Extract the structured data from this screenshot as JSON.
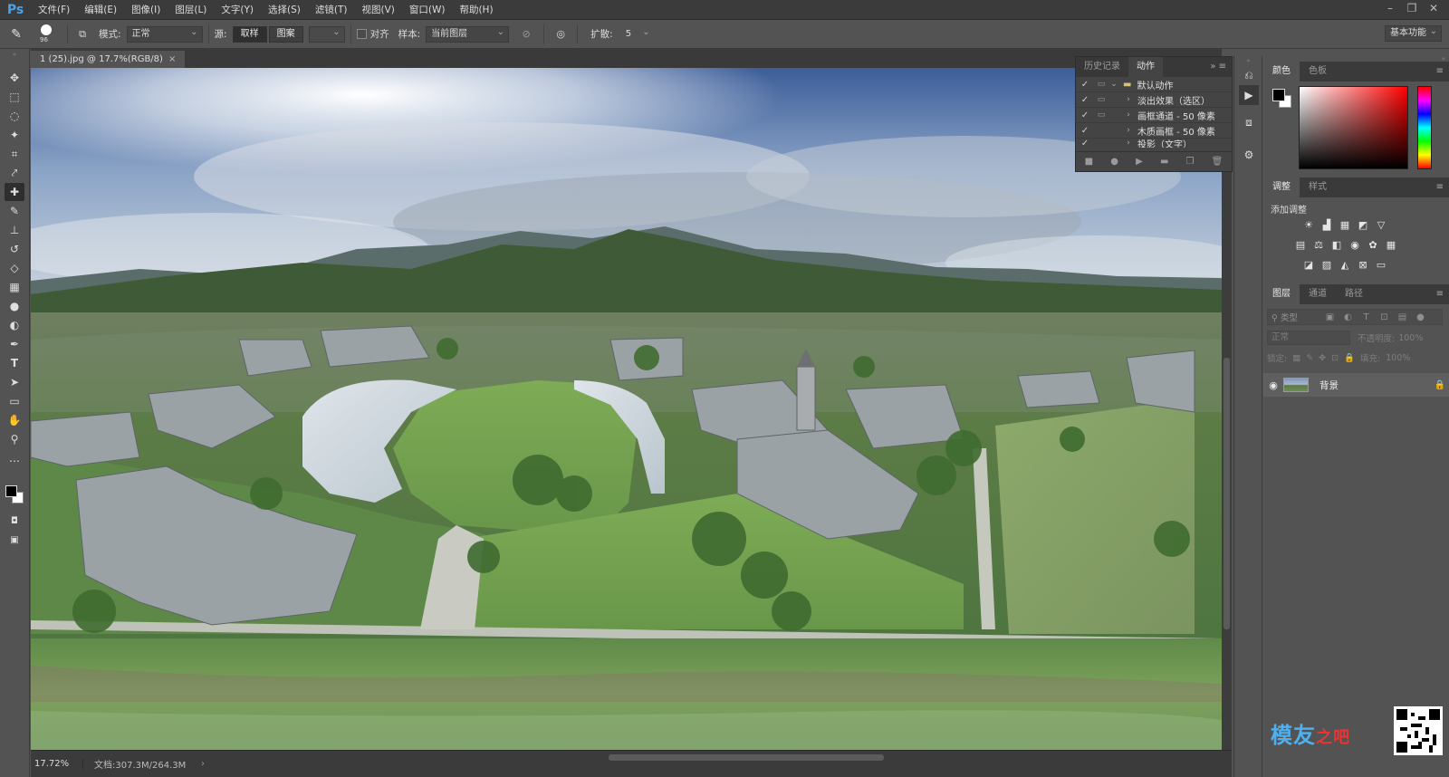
{
  "app": {
    "logo": "Ps",
    "workspace": "基本功能"
  },
  "menu": [
    "文件(F)",
    "编辑(E)",
    "图像(I)",
    "图层(L)",
    "文字(Y)",
    "选择(S)",
    "滤镜(T)",
    "视图(V)",
    "窗口(W)",
    "帮助(H)"
  ],
  "window_controls": [
    "–",
    "❐",
    "✕"
  ],
  "options": {
    "brush_size": "96",
    "mode_label": "模式:",
    "mode_value": "正常",
    "source_label": "源:",
    "source_sample": "取样",
    "source_pattern": "图案",
    "align_label": "对齐",
    "sample_label": "样本:",
    "sample_value": "当前图层",
    "diffusion_label": "扩散:",
    "diffusion_value": "5"
  },
  "document": {
    "tab_title": "1 (25).jpg @ 17.7%(RGB/8)",
    "close": "×"
  },
  "status": {
    "zoom": "17.72%",
    "doc_size": "文档:307.3M/264.3M"
  },
  "actions_panel": {
    "tabs": [
      "历史记录",
      "动作"
    ],
    "active_tab": "动作",
    "rows": [
      {
        "label": "默认动作",
        "checked": true,
        "expand": "⌄"
      },
      {
        "label": "淡出效果（选区）",
        "checked": true,
        "expand": "›"
      },
      {
        "label": "画框通道 - 50 像素",
        "checked": true,
        "expand": "›"
      },
      {
        "label": "木质画框 - 50 像素",
        "checked": true,
        "expand": "›"
      },
      {
        "label": "投影（文字）",
        "checked": true,
        "expand": "›"
      }
    ]
  },
  "color_panel": {
    "tabs": [
      "颜色",
      "色板"
    ],
    "active_tab": "颜色",
    "fg": "#000000",
    "bg": "#ffffff"
  },
  "adjust_panel": {
    "tabs": [
      "调整",
      "样式"
    ],
    "active_tab": "调整",
    "title": "添加调整"
  },
  "layers_panel": {
    "tabs": [
      "图层",
      "通道",
      "路径"
    ],
    "active_tab": "图层",
    "filter_type": "类型",
    "blend_mode": "正常",
    "opacity_label": "不透明度:",
    "opacity_value": "100%",
    "lock_label": "锁定:",
    "fill_label": "填充:",
    "fill_value": "100%",
    "layers": [
      {
        "name": "背景",
        "visible": true,
        "locked": true
      }
    ]
  },
  "watermark": {
    "text": "模友",
    "suffix": "之吧"
  }
}
